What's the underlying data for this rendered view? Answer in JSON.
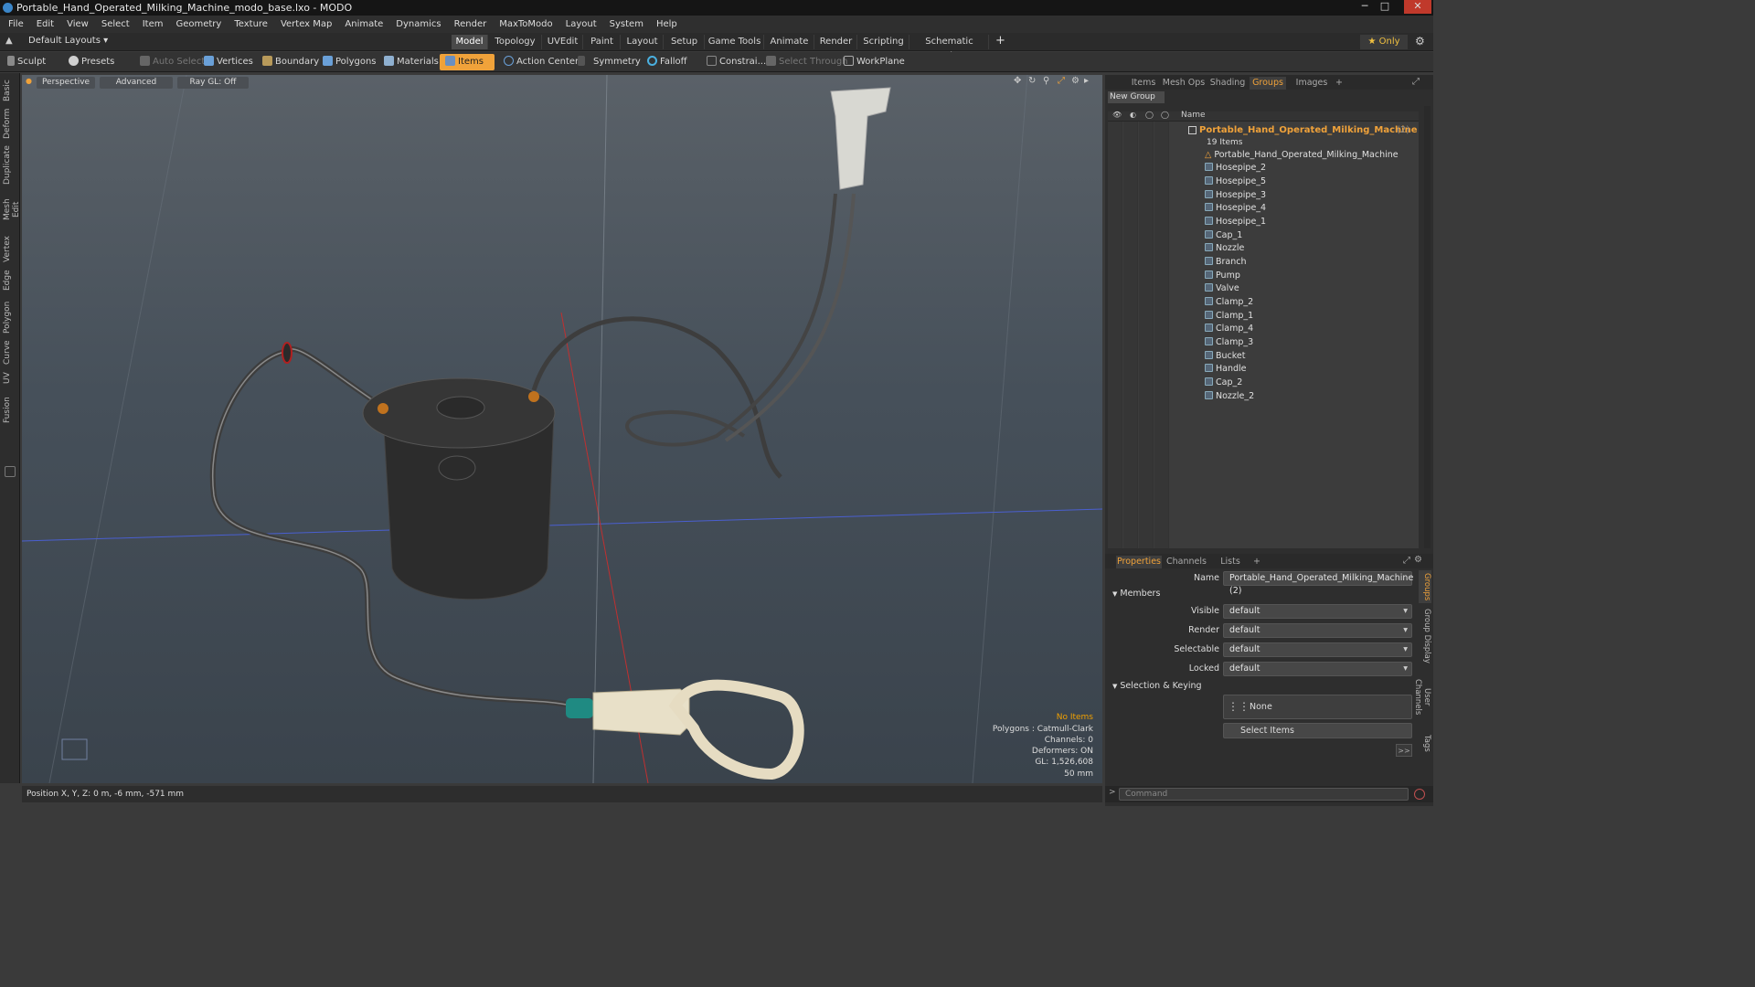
{
  "window": {
    "title": "Portable_Hand_Operated_Milking_Machine_modo_base.lxo - MODO",
    "minimize": "─",
    "maximize": "□",
    "close": "✕"
  },
  "menu": [
    "File",
    "Edit",
    "View",
    "Select",
    "Item",
    "Geometry",
    "Texture",
    "Vertex Map",
    "Animate",
    "Dynamics",
    "Render",
    "MaxToModo",
    "Layout",
    "System",
    "Help"
  ],
  "layoutbar": {
    "layout_selector": "Default Layouts ▾",
    "tabs": [
      "Model",
      "Topology",
      "UVEdit",
      "Paint",
      "Layout",
      "Setup",
      "Game Tools",
      "Animate",
      "Render",
      "Scripting",
      "Schematic Fusion"
    ],
    "active_tab": "Model",
    "add": "+",
    "only": "★  Only"
  },
  "toolbar": {
    "sculpt": "Sculpt",
    "presets": "Presets",
    "auto_select": "Auto Select",
    "vertices": "Vertices",
    "boundary": "Boundary",
    "polygons": "Polygons",
    "materials": "Materials",
    "items": "Items",
    "action_center": "Action Center",
    "symmetry": "Symmetry",
    "falloff": "Falloff",
    "constraints": "Constrai...",
    "select_through": "Select Through",
    "workplane": "WorkPlane"
  },
  "left_tabs": [
    "Basic",
    "Deform",
    "Duplicate",
    "Mesh Edit",
    "Vertex",
    "Edge",
    "Polygon",
    "Curve",
    "UV",
    "Fusion"
  ],
  "viewport": {
    "view": "Perspective",
    "advanced": "Advanced",
    "raygl": "Ray GL: Off",
    "info": {
      "selection": "No Items",
      "polygons": "Polygons : Catmull-Clark",
      "channels": "Channels: 0",
      "deformers": "Deformers: ON",
      "gl": "GL: 1,526,608",
      "scale": "50 mm"
    }
  },
  "status": {
    "position": "Position X, Y, Z:  0 m, -6 mm, -571 mm"
  },
  "right_panel": {
    "tabs": [
      "Items",
      "Mesh Ops",
      "Shading",
      "Groups",
      "Images"
    ],
    "active_tab": "Groups",
    "add": "+",
    "new_group": "New Group",
    "column_name": "Name",
    "group_name": "Portable_Hand_Operated_Milking_Machine",
    "group_count": "(2)",
    "group_items": "19 Items",
    "items": [
      "Portable_Hand_Operated_Milking_Machine",
      "Hosepipe_2",
      "Hosepipe_5",
      "Hosepipe_3",
      "Hosepipe_4",
      "Hosepipe_1",
      "Cap_1",
      "Nozzle",
      "Branch",
      "Pump",
      "Valve",
      "Clamp_2",
      "Clamp_1",
      "Clamp_4",
      "Clamp_3",
      "Bucket",
      "Handle",
      "Cap_2",
      "Nozzle_2"
    ]
  },
  "properties": {
    "tabs": [
      "Properties",
      "Channels",
      "Lists"
    ],
    "active_tab": "Properties",
    "add": "+",
    "name_label": "Name",
    "name_value": "Portable_Hand_Operated_Milking_Machine (2)",
    "members_section": "Members",
    "visible_label": "Visible",
    "visible_value": "default",
    "render_label": "Render",
    "render_value": "default",
    "selectable_label": "Selectable",
    "selectable_value": "default",
    "locked_label": "Locked",
    "locked_value": "default",
    "keying_section": "Selection & Keying",
    "none_label": "None",
    "select_items": "Select Items",
    "more": ">>",
    "side_tabs": [
      "Groups",
      "Group Display",
      "User Channels",
      "Tags"
    ]
  },
  "command": {
    "placeholder": "Command",
    "prompt": ">"
  }
}
